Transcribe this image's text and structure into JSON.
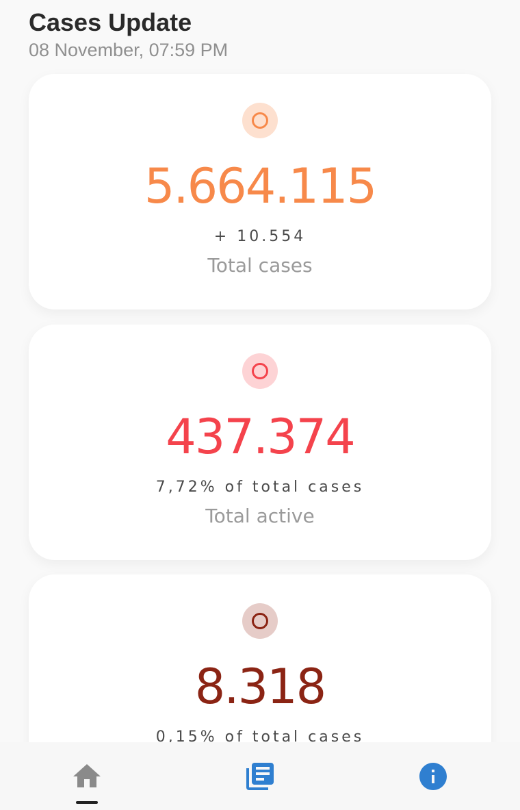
{
  "header": {
    "title": "Cases Update",
    "datetime": "08 November, 07:59 PM"
  },
  "cards": [
    {
      "value": "5.664.115",
      "sub": "+ 10.554",
      "label": "Total cases",
      "color": "#f7894a",
      "dot_bg": "#fde0cf"
    },
    {
      "value": "437.374",
      "sub": "7,72% of total cases",
      "label": "Total active",
      "color": "#f4434c",
      "dot_bg": "#fdd3d5"
    },
    {
      "value": "8.318",
      "sub": "0,15% of total cases",
      "label": "",
      "color": "#8b2414",
      "dot_bg": "#e6ccc8"
    }
  ],
  "nav": {
    "items": [
      {
        "name": "home",
        "icon": "home-icon",
        "active": true,
        "color": "#8a8a8a"
      },
      {
        "name": "news",
        "icon": "news-icon",
        "active": false,
        "color": "#2f7fd0"
      },
      {
        "name": "info",
        "icon": "info-icon",
        "active": false,
        "color": "#2f7fd0"
      }
    ]
  }
}
